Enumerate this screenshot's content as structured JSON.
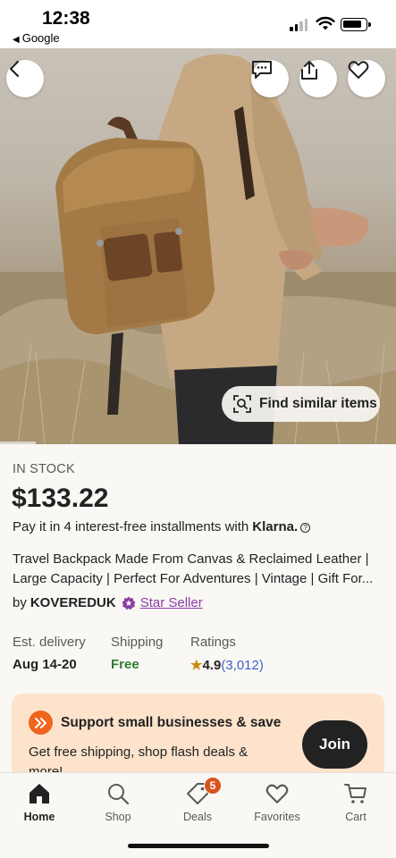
{
  "status_bar": {
    "time": "12:38",
    "back_app": "Google"
  },
  "hero": {
    "find_similar_label": "Find similar items"
  },
  "product": {
    "stock": "IN STOCK",
    "price": "$133.22",
    "installments_text": "Pay it in 4 interest-free installments with",
    "installments_brand": "Klarna.",
    "title_line1": "Travel Backpack Made From Canvas & Reclaimed Leather |",
    "title_line2": "Large Capacity | Perfect For Adventures | Vintage | Gift For...",
    "seller_prefix": "by",
    "seller_name": "KOVEREDUK",
    "star_seller_label": "Star Seller"
  },
  "details": {
    "delivery_label": "Est. delivery",
    "delivery_value": "Aug 14-20",
    "shipping_label": "Shipping",
    "shipping_value": "Free",
    "ratings_label": "Ratings",
    "rating_value": "4.9",
    "rating_count": "(3,012)"
  },
  "promo": {
    "title": "Support small businesses & save",
    "body": "Get free shipping, shop flash deals & more!",
    "join_label": "Join"
  },
  "tabbar": {
    "items": [
      {
        "label": "Home",
        "icon": "home-icon"
      },
      {
        "label": "Shop",
        "icon": "search-icon"
      },
      {
        "label": "Deals",
        "icon": "tag-icon",
        "badge": "5"
      },
      {
        "label": "Favorites",
        "icon": "heart-icon"
      },
      {
        "label": "Cart",
        "icon": "cart-icon"
      }
    ]
  },
  "colors": {
    "accent": "#f1641e",
    "star_seller": "#8a3ea6",
    "free": "#2f7d32",
    "rating_count": "#3b5fc7",
    "promo_bg": "#fde3cc"
  }
}
